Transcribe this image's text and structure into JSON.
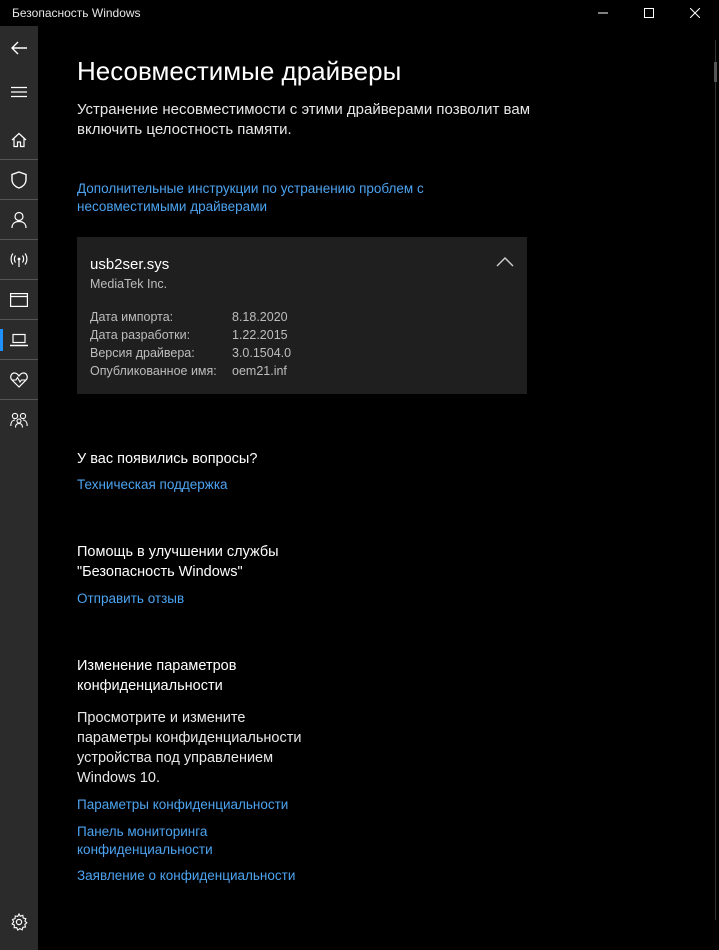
{
  "window": {
    "title": "Безопасность Windows"
  },
  "sidebar": {
    "items": [
      {
        "name": "back",
        "icon": "back-arrow-icon"
      },
      {
        "name": "menu",
        "icon": "hamburger-menu-icon"
      },
      {
        "name": "home",
        "icon": "home-icon"
      },
      {
        "name": "virus-protection",
        "icon": "shield-icon"
      },
      {
        "name": "account-protection",
        "icon": "person-icon"
      },
      {
        "name": "firewall-network",
        "icon": "wireless-icon"
      },
      {
        "name": "app-browser-control",
        "icon": "browser-window-icon"
      },
      {
        "name": "device-security",
        "icon": "laptop-icon",
        "active": true
      },
      {
        "name": "device-performance",
        "icon": "heart-pulse-icon"
      },
      {
        "name": "family-options",
        "icon": "family-icon"
      },
      {
        "name": "settings",
        "icon": "gear-icon"
      }
    ],
    "accent_color": "#1e90ff"
  },
  "main": {
    "title": "Несовместимые драйверы",
    "description": "Устранение несовместимости с этими драйверами позволит вам включить целостность памяти.",
    "help_link": "Дополнительные инструкции по устранению проблем с несовместимыми драйверами",
    "driver": {
      "name": "usb2ser.sys",
      "vendor": "MediaTek Inc.",
      "properties": [
        {
          "label": "Дата импорта:",
          "value": "8.18.2020"
        },
        {
          "label": "Дата разработки:",
          "value": "1.22.2015"
        },
        {
          "label": "Версия драйвера:",
          "value": "3.0.1504.0"
        },
        {
          "label": "Опубликованное имя:",
          "value": "oem21.inf"
        }
      ]
    },
    "questions": {
      "heading": "У вас появились вопросы?",
      "link": "Техническая поддержка"
    },
    "improve": {
      "heading_line1": "Помощь в улучшении службы",
      "heading_line2": "\"Безопасность Windows\"",
      "link": "Отправить отзыв"
    },
    "privacy": {
      "heading": "Изменение параметров конфиденциальности",
      "text": "Просмотрите и измените параметры конфиденциальности устройства под управлением Windows 10.",
      "links": [
        "Параметры конфиденциальности",
        "Панель мониторинга конфиденциальности",
        "Заявление о конфиденциальности"
      ]
    },
    "link_color": "#4ca3f0"
  }
}
